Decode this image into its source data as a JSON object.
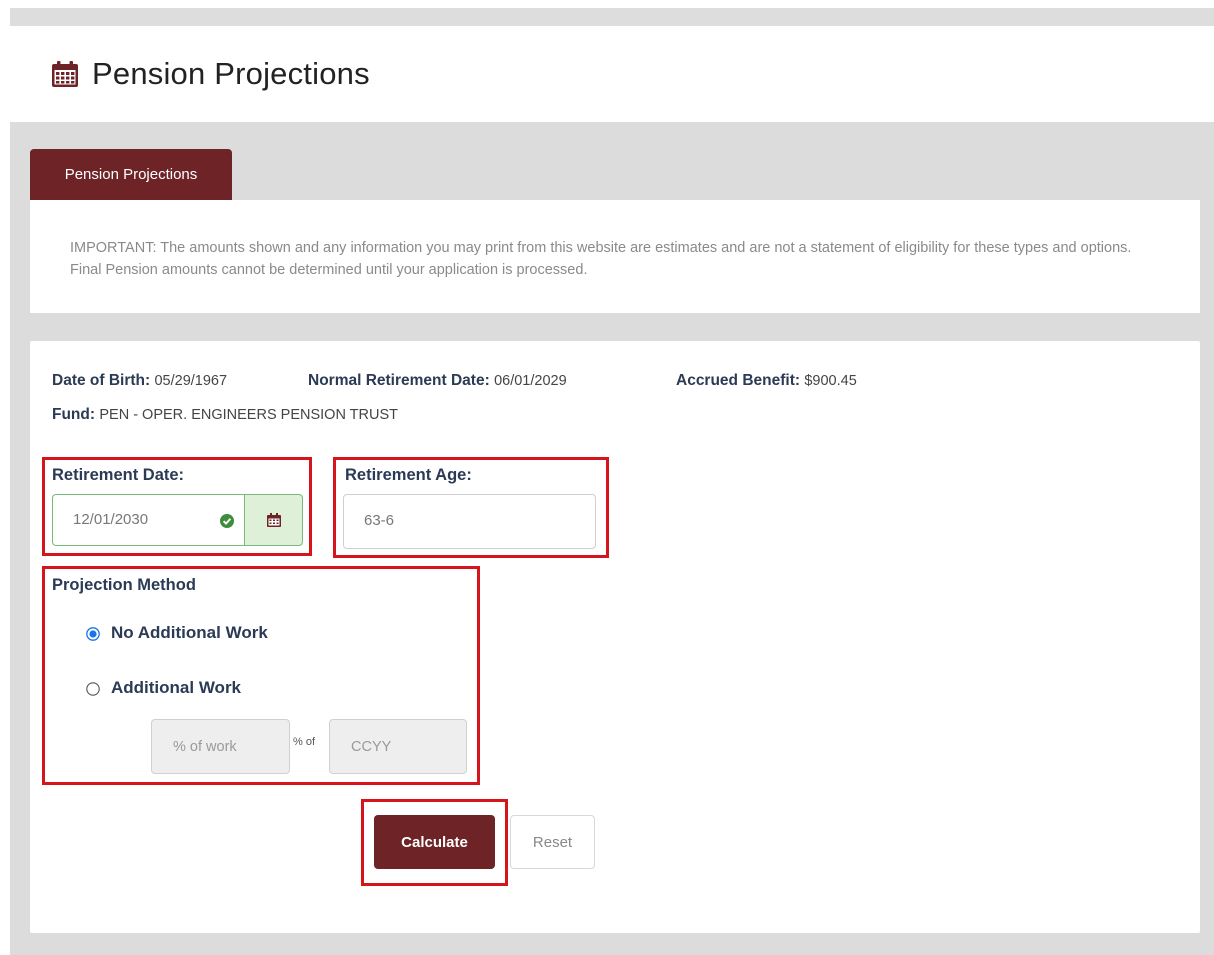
{
  "header": {
    "title": "Pension Projections",
    "icon": "calendar-icon"
  },
  "tab": {
    "label": "Pension Projections"
  },
  "notice": {
    "text": "IMPORTANT: The amounts shown and any information you may print from this website are estimates and are not a statement of eligibility for these types and options. Final Pension amounts cannot be determined until your application is processed."
  },
  "info": {
    "dob_label": "Date of Birth:",
    "dob_value": "05/29/1967",
    "nrd_label": "Normal Retirement Date:",
    "nrd_value": "06/01/2029",
    "accrued_label": "Accrued Benefit:",
    "accrued_value": "$900.45",
    "fund_label": "Fund:",
    "fund_value": "PEN - OPER. ENGINEERS PENSION TRUST"
  },
  "retirement_date": {
    "label": "Retirement Date:",
    "value": "12/01/2030"
  },
  "retirement_age": {
    "label": "Retirement Age:",
    "value": "63-6"
  },
  "projection": {
    "label": "Projection Method",
    "options": [
      {
        "label": "No Additional Work",
        "selected": true
      },
      {
        "label": "Additional Work",
        "selected": false
      }
    ],
    "percent_placeholder": "% of work",
    "of_text": "% of",
    "year_placeholder": "CCYY"
  },
  "buttons": {
    "calculate": "Calculate",
    "reset": "Reset"
  },
  "colors": {
    "brand": "#6e2327",
    "highlight": "#d6141b",
    "success": "#3c8d3c"
  }
}
